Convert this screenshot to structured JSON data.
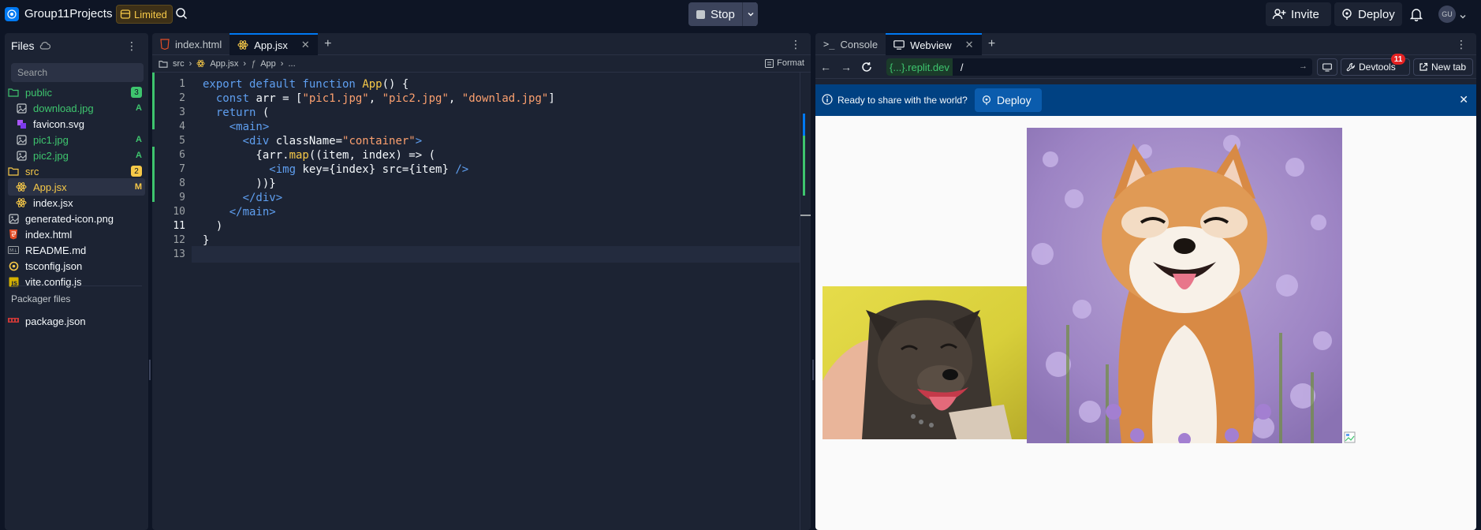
{
  "topbar": {
    "project": "Group11Projects",
    "plan": "Limited",
    "stop": "Stop",
    "invite": "Invite",
    "deploy": "Deploy",
    "avatar": "GU"
  },
  "files": {
    "title": "Files",
    "search_placeholder": "Search",
    "items": [
      {
        "name": "public",
        "badge": "3"
      },
      {
        "name": "download.jpg",
        "badge": "A"
      },
      {
        "name": "favicon.svg",
        "badge": ""
      },
      {
        "name": "pic1.jpg",
        "badge": "A"
      },
      {
        "name": "pic2.jpg",
        "badge": "A"
      },
      {
        "name": "src",
        "badge": "2"
      },
      {
        "name": "App.jsx",
        "badge": "M"
      },
      {
        "name": "index.jsx",
        "badge": ""
      },
      {
        "name": "generated-icon.png",
        "badge": ""
      },
      {
        "name": "index.html",
        "badge": ""
      },
      {
        "name": "README.md",
        "badge": ""
      },
      {
        "name": "tsconfig.json",
        "badge": ""
      },
      {
        "name": "vite.config.js",
        "badge": ""
      }
    ],
    "packager_title": "Packager files",
    "packager_items": [
      {
        "name": "package.json"
      }
    ]
  },
  "editor": {
    "tabs": [
      {
        "label": "index.html"
      },
      {
        "label": "App.jsx"
      }
    ],
    "breadcrumb": [
      "src",
      "App.jsx",
      "App",
      "..."
    ],
    "format": "Format",
    "lines": [
      "1",
      "2",
      "3",
      "4",
      "5",
      "6",
      "7",
      "8",
      "9",
      "10",
      "11",
      "12",
      "13"
    ],
    "current_line": "11"
  },
  "webview": {
    "tabs": [
      {
        "label": "Console"
      },
      {
        "label": "Webview"
      }
    ],
    "url_host": "{...}.replit.dev",
    "url_path": "/",
    "devtools": "Devtools",
    "devtools_badge": "11",
    "new_tab": "New tab",
    "banner_text": "Ready to share with the world?",
    "banner_deploy": "Deploy"
  }
}
